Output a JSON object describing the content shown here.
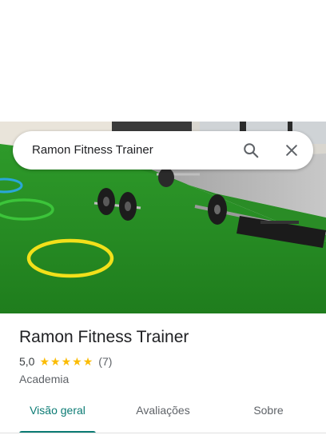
{
  "search": {
    "query": "Ramon Fitness Trainer",
    "search_icon": "search-icon",
    "close_icon": "close-icon"
  },
  "place": {
    "name": "Ramon Fitness Trainer",
    "rating": "5,0",
    "stars": 5,
    "review_count": "(7)",
    "category": "Academia"
  },
  "tabs": [
    {
      "label": "Visão geral",
      "active": true
    },
    {
      "label": "Avaliações",
      "active": false
    },
    {
      "label": "Sobre",
      "active": false
    }
  ],
  "colors": {
    "accent": "#0b7b74",
    "star": "#fbbc04",
    "turf": "#2f8f2a"
  }
}
